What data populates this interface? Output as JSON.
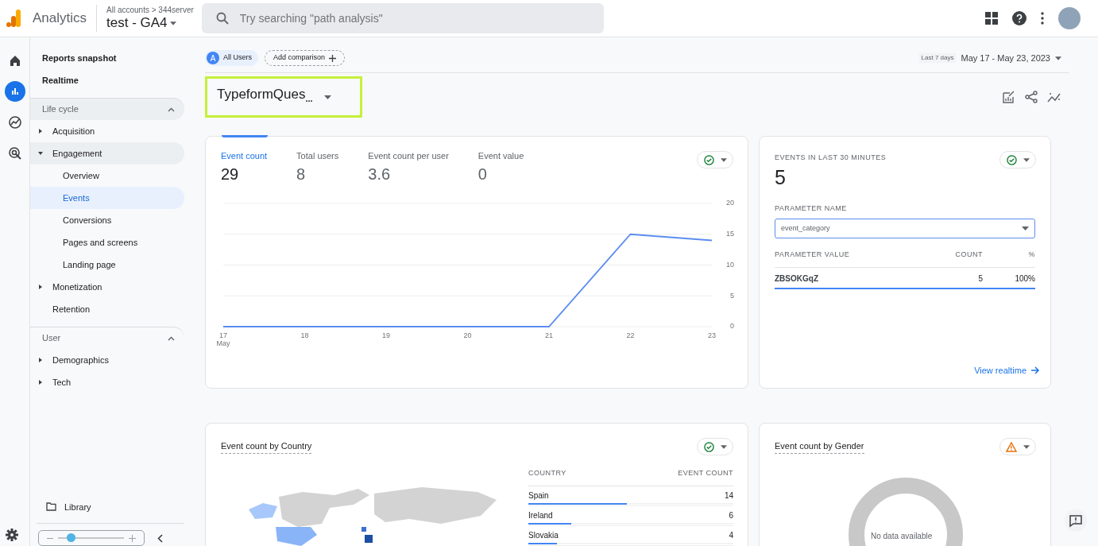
{
  "header": {
    "product": "Analytics",
    "breadcrumb": "All accounts > 344server",
    "property": "test - GA4",
    "search": {
      "placeholder": "Try searching \"path analysis\""
    }
  },
  "rail": [
    {
      "kind": "home",
      "selected": false
    },
    {
      "kind": "reports",
      "selected": true
    },
    {
      "kind": "explore",
      "selected": false
    },
    {
      "kind": "advertising",
      "selected": false
    }
  ],
  "sidebar": {
    "top_items": [
      {
        "label": "Reports snapshot",
        "selected": false
      },
      {
        "label": "Realtime",
        "selected": false
      }
    ],
    "sections": [
      {
        "title": "Life cycle",
        "expanded": true,
        "items": [
          {
            "label": "Acquisition",
            "expanded": false,
            "selected": false
          },
          {
            "label": "Engagement",
            "expanded": true,
            "selected": false,
            "children": [
              {
                "label": "Overview",
                "selected": false
              },
              {
                "label": "Events",
                "selected": true
              },
              {
                "label": "Conversions",
                "selected": false
              },
              {
                "label": "Pages and screens",
                "selected": false
              },
              {
                "label": "Landing page",
                "selected": false
              }
            ]
          },
          {
            "label": "Monetization",
            "expanded": false,
            "selected": false
          },
          {
            "label": "Retention",
            "selected": false
          }
        ]
      },
      {
        "title": "User",
        "expanded": true,
        "items": [
          {
            "label": "Demographics",
            "expanded": false,
            "selected": false
          },
          {
            "label": "Tech",
            "expanded": false,
            "selected": false
          }
        ]
      }
    ],
    "library": "Library"
  },
  "comparison": {
    "segment_badge": "A",
    "segment": "All Users",
    "add": "Add comparison"
  },
  "date_range": {
    "preset": "Last 7 days",
    "range": "May 17 - May 23, 2023"
  },
  "report_title": {
    "text": "TypeformQues",
    "ellipsis": "..."
  },
  "metrics_card": {
    "metrics": [
      {
        "label": "Event count",
        "value": "29",
        "selected": true
      },
      {
        "label": "Total users",
        "value": "8",
        "selected": false
      },
      {
        "label": "Event count per user",
        "value": "3.6",
        "selected": false
      },
      {
        "label": "Event value",
        "value": "0",
        "selected": false
      }
    ],
    "warning": false,
    "chart_data": {
      "type": "line",
      "categories": [
        "17 May",
        "18",
        "19",
        "20",
        "21",
        "22",
        "23"
      ],
      "series": [
        {
          "color": "#5b8def",
          "values": [
            0,
            0,
            0,
            0,
            0,
            15,
            14
          ]
        }
      ],
      "ylim": [
        0,
        20
      ],
      "yticks": [
        0,
        5,
        10,
        15,
        20
      ],
      "grid": true
    }
  },
  "realtime_card": {
    "title": "EVENTS IN LAST 30 MINUTES",
    "value": "5",
    "warning": false,
    "parameter_label": "PARAMETER NAME",
    "parameter_value": "event_category",
    "columns": [
      "PARAMETER VALUE",
      "COUNT",
      "%"
    ],
    "rows": [
      {
        "cells": [
          "ZBSOKGqZ",
          "5",
          "100%"
        ],
        "level": 1
      }
    ],
    "link": "View realtime"
  },
  "country_card": {
    "title": "Event count by Country",
    "warning": false,
    "columns": [
      "COUNTRY",
      "EVENT COUNT"
    ],
    "rows": [
      {
        "country": "Spain",
        "count": "14",
        "level": 0.48
      },
      {
        "country": "Ireland",
        "count": "6",
        "level": 0.21
      },
      {
        "country": "Slovakia",
        "count": "4",
        "level": 0.14
      }
    ]
  },
  "gender_card": {
    "title": "Event count by Gender",
    "warning": true,
    "empty": "No data available"
  },
  "zoom_control": {
    "level": 0.2
  }
}
